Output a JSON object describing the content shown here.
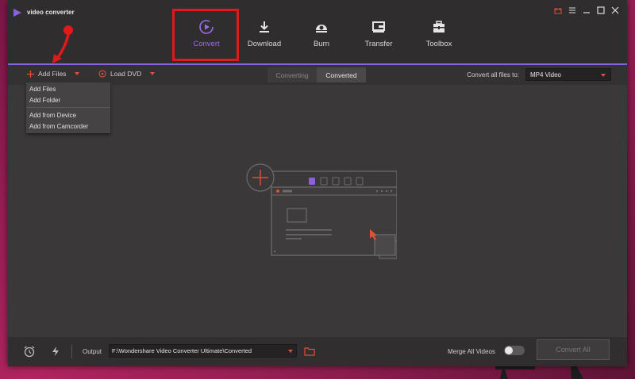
{
  "app": {
    "title": "video converter"
  },
  "nav": {
    "items": [
      {
        "label": "Convert",
        "icon": "convert-icon",
        "active": true
      },
      {
        "label": "Download",
        "icon": "download-icon",
        "active": false
      },
      {
        "label": "Burn",
        "icon": "burn-icon",
        "active": false
      },
      {
        "label": "Transfer",
        "icon": "transfer-icon",
        "active": false
      },
      {
        "label": "Toolbox",
        "icon": "toolbox-icon",
        "active": false
      }
    ]
  },
  "toolbar": {
    "add_files_label": "Add Files",
    "load_dvd_label": "Load DVD",
    "tabs": [
      {
        "label": "Converting",
        "active": false
      },
      {
        "label": "Converted",
        "active": true
      }
    ],
    "convert_all_files_label": "Convert all files to:",
    "format_value": "MP4 Video"
  },
  "add_files_menu": {
    "items": [
      "Add Files",
      "Add Folder",
      "Add from Device",
      "Add from Camcorder"
    ]
  },
  "bottom": {
    "output_label": "Output",
    "output_path": "F:\\Wondershare Video Converter Ultimate\\Converted",
    "merge_label": "Merge All Videos",
    "merge_on": false,
    "convert_all_label": "Convert All"
  },
  "colors": {
    "accent": "#8b62d9",
    "highlight_box": "#e01a1a",
    "orange": "#e0503a",
    "background": "#3a3839"
  }
}
